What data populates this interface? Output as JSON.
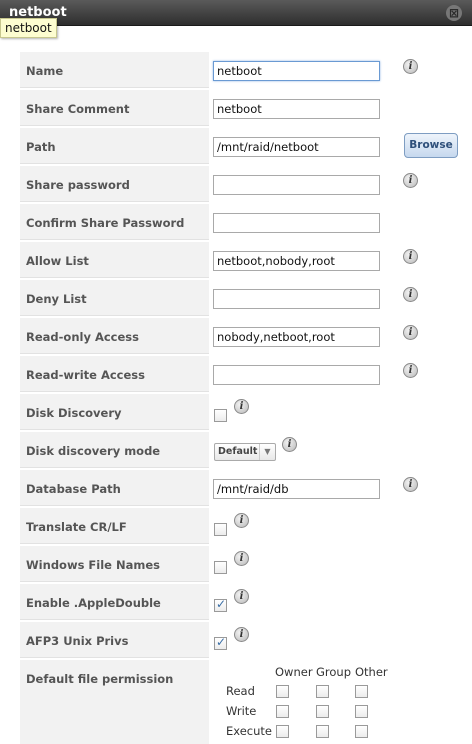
{
  "window": {
    "title": "netboot",
    "tooltip": "netboot",
    "close_glyph": "⊠"
  },
  "form": {
    "rows": [
      {
        "label": "Name",
        "type": "text",
        "value": "netboot",
        "info": true
      },
      {
        "label": "Share Comment",
        "type": "text",
        "value": "netboot",
        "info": false
      },
      {
        "label": "Path",
        "type": "text",
        "value": "/mnt/raid/netboot",
        "info": false,
        "button": "Browse"
      },
      {
        "label": "Share password",
        "type": "text",
        "value": "",
        "info": true
      },
      {
        "label": "Confirm Share Password",
        "type": "text",
        "value": "",
        "info": false
      },
      {
        "label": "Allow List",
        "type": "text",
        "value": "netboot,nobody,root",
        "info": true
      },
      {
        "label": "Deny List",
        "type": "text",
        "value": "",
        "info": true
      },
      {
        "label": "Read-only Access",
        "type": "text",
        "value": "nobody,netboot,root",
        "info": true
      },
      {
        "label": "Read-write Access",
        "type": "text",
        "value": "",
        "info": true
      },
      {
        "label": "Disk Discovery",
        "type": "checkbox",
        "checked": false,
        "info": true
      },
      {
        "label": "Disk discovery mode",
        "type": "select",
        "value": "Default",
        "info": true
      },
      {
        "label": "Database Path",
        "type": "text",
        "value": "/mnt/raid/db",
        "info": true
      },
      {
        "label": "Translate CR/LF",
        "type": "checkbox",
        "checked": false,
        "info": true
      },
      {
        "label": "Windows File Names",
        "type": "checkbox",
        "checked": false,
        "info": true
      },
      {
        "label": "Enable .AppleDouble",
        "type": "checkbox",
        "checked": true,
        "info": true
      },
      {
        "label": "AFP3 Unix Privs",
        "type": "checkbox",
        "checked": true,
        "info": true
      }
    ],
    "permissions": {
      "label": "Default file permission",
      "columns": [
        "Owner",
        "Group",
        "Other"
      ],
      "rows": [
        "Read",
        "Write",
        "Execute"
      ]
    }
  },
  "info_glyph": "i",
  "select_arrow_glyph": "▼"
}
